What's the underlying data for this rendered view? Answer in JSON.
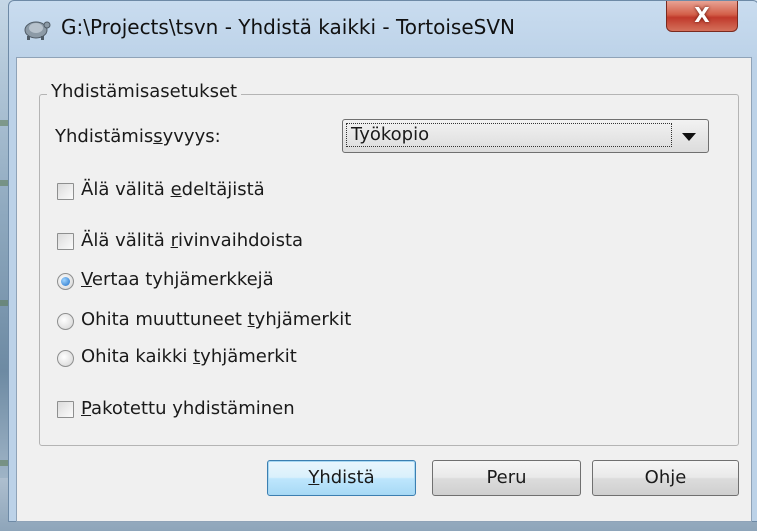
{
  "window": {
    "title": "G:\\Projects\\tsvn - Yhdistä kaikki - TortoiseSVN",
    "close_glyph": "X"
  },
  "group": {
    "label": "Yhdistämisasetukset"
  },
  "depth": {
    "label_pre": "Yhdistämis",
    "label_key": "s",
    "label_post": "yvyys:",
    "selected": "Työkopio"
  },
  "options": {
    "ignore_ancestry": {
      "pre": "Älä välitä ",
      "key": "e",
      "post": "deltäjistä",
      "checked": false
    },
    "ignore_eol": {
      "pre": "Älä välitä ",
      "key": "r",
      "post": "ivinvaihdoista",
      "checked": false
    },
    "compare_ws": {
      "pre": "",
      "key": "V",
      "post": "ertaa tyhjämerkkejä",
      "selected": true
    },
    "ignore_ws_changes": {
      "pre": "Ohita muuttuneet ",
      "key": "t",
      "post": "yhjämerkit",
      "selected": false
    },
    "ignore_all_ws": {
      "pre": "Ohita kaikki ",
      "key": "t",
      "post": "yhjämerkit",
      "selected": false
    },
    "force": {
      "pre": "",
      "key": "P",
      "post": "akotettu yhdistäminen",
      "checked": false
    }
  },
  "buttons": {
    "merge": {
      "key": "Y",
      "post": "hdistä"
    },
    "cancel": "Peru",
    "help": "Ohje"
  },
  "colors": {
    "accent": "#3c7fb1",
    "close": "#c0392b",
    "radio_dot": "#1f6fc7"
  }
}
